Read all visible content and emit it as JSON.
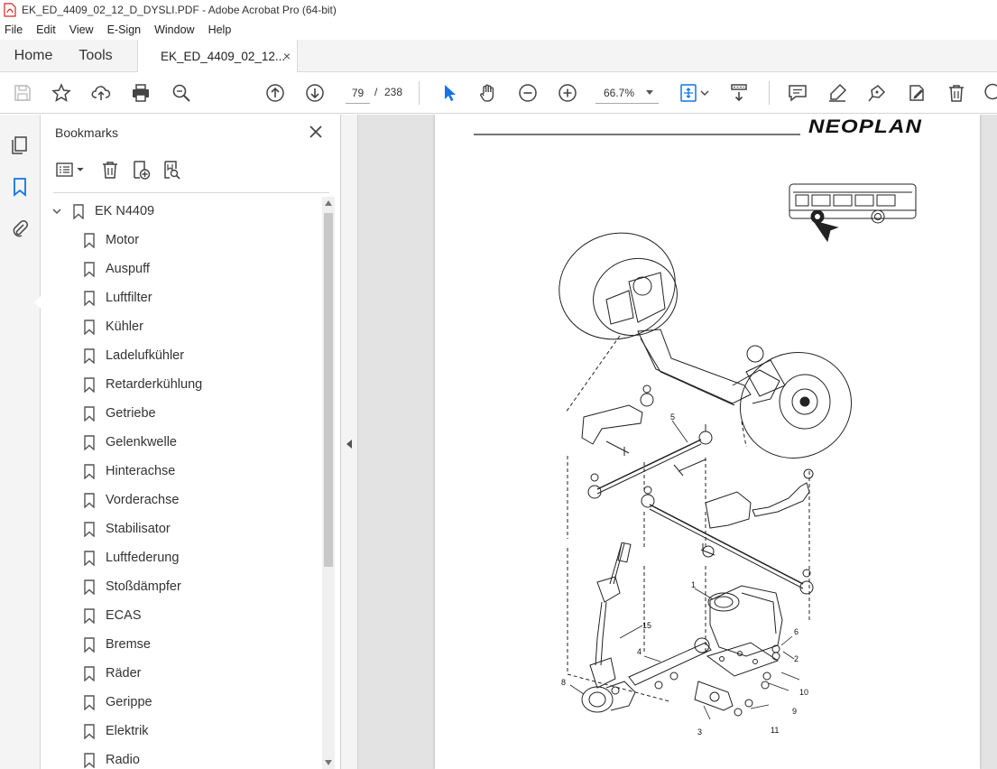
{
  "window": {
    "title": "EK_ED_4409_02_12_D_DYSLI.PDF - Adobe Acrobat Pro (64-bit)"
  },
  "menu": [
    "File",
    "Edit",
    "View",
    "E-Sign",
    "Window",
    "Help"
  ],
  "tabs": {
    "home": "Home",
    "tools": "Tools",
    "document": "EK_ED_4409_02_12...",
    "close_glyph": "×"
  },
  "toolbar": {
    "page_current": "79",
    "page_separator": "/",
    "page_total": "238",
    "zoom": "66.7%"
  },
  "bookmarks": {
    "title": "Bookmarks",
    "root": "EK N4409",
    "items": [
      "Motor",
      "Auspuff",
      "Luftfilter",
      "Kühler",
      "Ladelufkühler",
      "Retarderkühlung",
      "Getriebe",
      "Gelenkwelle",
      "Hinterachse",
      "Vorderachse",
      "Stabilisator",
      "Luftfederung",
      "Stoßdämpfer",
      "ECAS",
      "Bremse",
      "Räder",
      "Gerippe",
      "Elektrik",
      "Radio"
    ]
  },
  "document": {
    "brand": "NEOPLAN",
    "callouts": [
      "1",
      "2",
      "3",
      "4",
      "5",
      "6",
      "8",
      "9",
      "10",
      "11",
      "15"
    ]
  },
  "colors": {
    "accent": "#1473e6",
    "pdf_red": "#d9261c"
  }
}
